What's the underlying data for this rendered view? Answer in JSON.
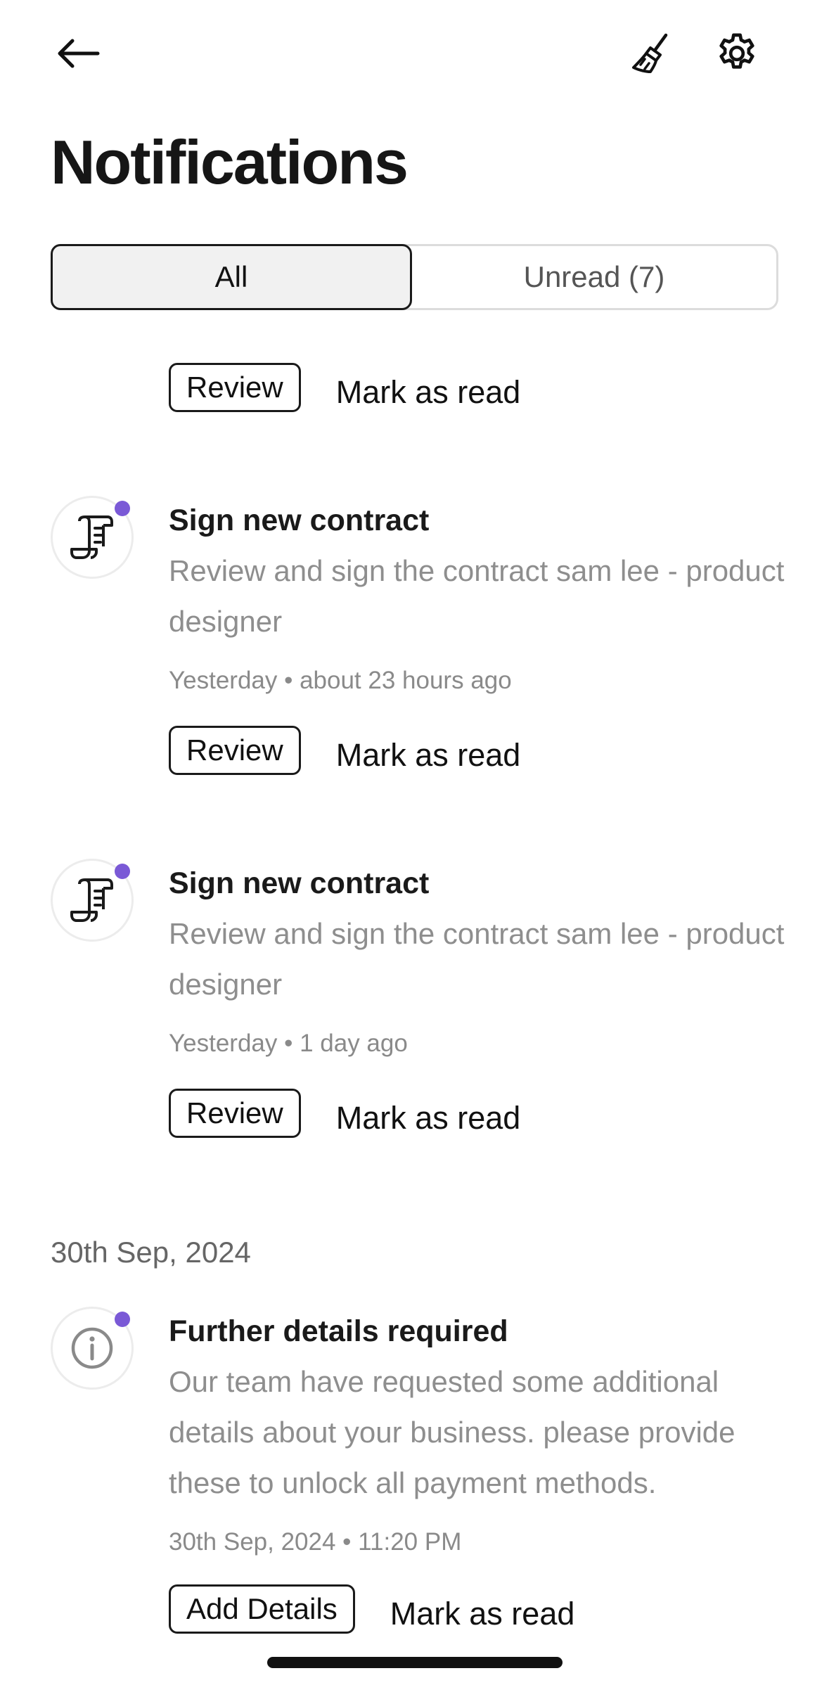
{
  "header": {
    "back_icon": "arrow-left-icon",
    "clear_icon": "broom-icon",
    "settings_icon": "gear-icon",
    "title": "Notifications"
  },
  "tabs": [
    {
      "label": "All",
      "active": true
    },
    {
      "label": "Unread (7)",
      "active": false
    }
  ],
  "partial_item": {
    "primary_action": "Review",
    "secondary_action": "Mark as read"
  },
  "notifications": [
    {
      "icon": "contract-scroll-icon",
      "unread": true,
      "title": "Sign new contract",
      "description": "Review and sign the contract sam lee - product designer",
      "meta": "Yesterday • about 23 hours ago",
      "primary_action": "Review",
      "secondary_action": "Mark as read"
    },
    {
      "icon": "contract-scroll-icon",
      "unread": true,
      "title": "Sign new contract",
      "description": "Review and sign the contract sam lee - product designer",
      "meta": "Yesterday • 1 day ago",
      "primary_action": "Review",
      "secondary_action": "Mark as read"
    },
    {
      "icon": "info-icon",
      "unread": true,
      "title": "Further details required",
      "description": "Our team have requested some additional details about your business. please provide these to unlock all payment methods.",
      "meta": "30th Sep, 2024 • 11:20 PM",
      "primary_action": "Add Details",
      "secondary_action": "Mark as read"
    }
  ],
  "section_date": "30th Sep, 2024",
  "colors": {
    "unread_dot": "#7a59d6",
    "text_primary": "#1a1a1a",
    "text_secondary": "#8e8e8e"
  }
}
